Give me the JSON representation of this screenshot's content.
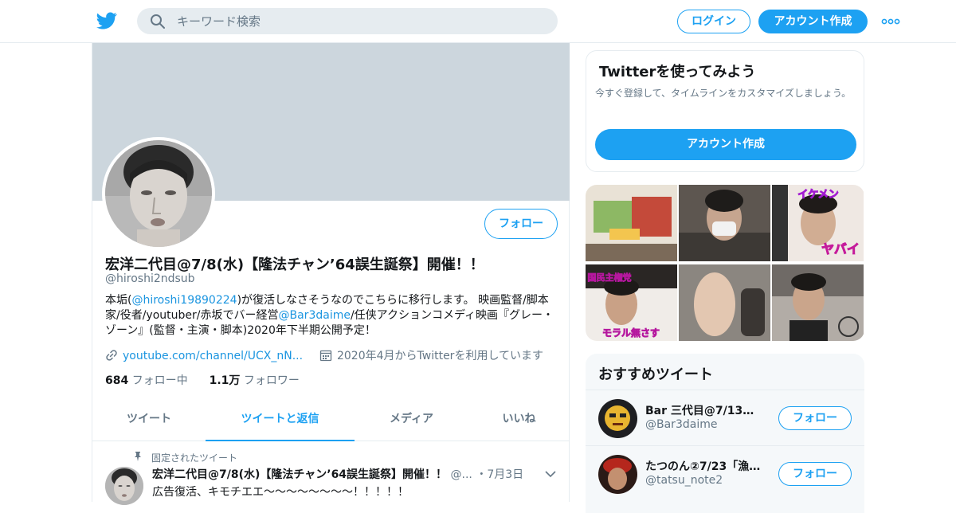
{
  "header": {
    "search_placeholder": "キーワード検索",
    "login_label": "ログイン",
    "signup_label": "アカウント作成"
  },
  "profile": {
    "name": "宏洋二代目@7/8(水)【隆法チャン’64誤生誕祭】開催！！",
    "handle": "@hiroshi2ndsub",
    "follow_label": "フォロー",
    "bio_1": "本垢(",
    "bio_mention_1": "@hiroshi19890224",
    "bio_2": ")が復活しなさそうなのでこちらに移行します。 映画監督/脚本家/役者/youtuber/赤坂でバー経営",
    "bio_mention_2": "@Bar3daime",
    "bio_3": "/任侠アクションコメディ映画『グレー・ゾーン』(監督・主演・脚本)2020年下半期公開予定！",
    "link": "youtube.com/channel/UCX_nN...",
    "joined": "2020年4月からTwitterを利用しています",
    "following_count": "684",
    "following_label": "フォロー中",
    "followers_count": "1.1万",
    "followers_label": "フォロワー"
  },
  "tabs": [
    "ツイート",
    "ツイートと返信",
    "メディア",
    "いいね"
  ],
  "active_tab": 1,
  "pinned_tweet": {
    "label": "固定されたツイート",
    "author": "宏洋二代目@7/8(水)【隆法チャン’64誤生誕祭】開催！！",
    "handle_short": "@...",
    "date": "・7月3日",
    "text": "広告復活、キモチエエ〜〜〜〜〜〜〜〜！！！！！"
  },
  "sidebar": {
    "signup_card": {
      "title": "Twitterを使ってみよう",
      "text": "今すぐ登録して、タイムラインをカスタマイズしましょう。",
      "button": "アカウント作成"
    },
    "media_labels": [
      "イケメン",
      "ヤバイ",
      "国民主権党",
      "モラル無さす"
    ],
    "reco_title": "おすすめツイート",
    "reco": [
      {
        "name": "Bar 三代目@7/13み…",
        "handle": "@Bar3daime",
        "button": "フォロー"
      },
      {
        "name": "たつのん②7/23「漁…",
        "handle": "@tatsu_note2",
        "button": "フォロー"
      }
    ]
  },
  "colors": {
    "accent": "#1da1f2",
    "banner": "#ccd6dd",
    "muted": "#657786"
  }
}
